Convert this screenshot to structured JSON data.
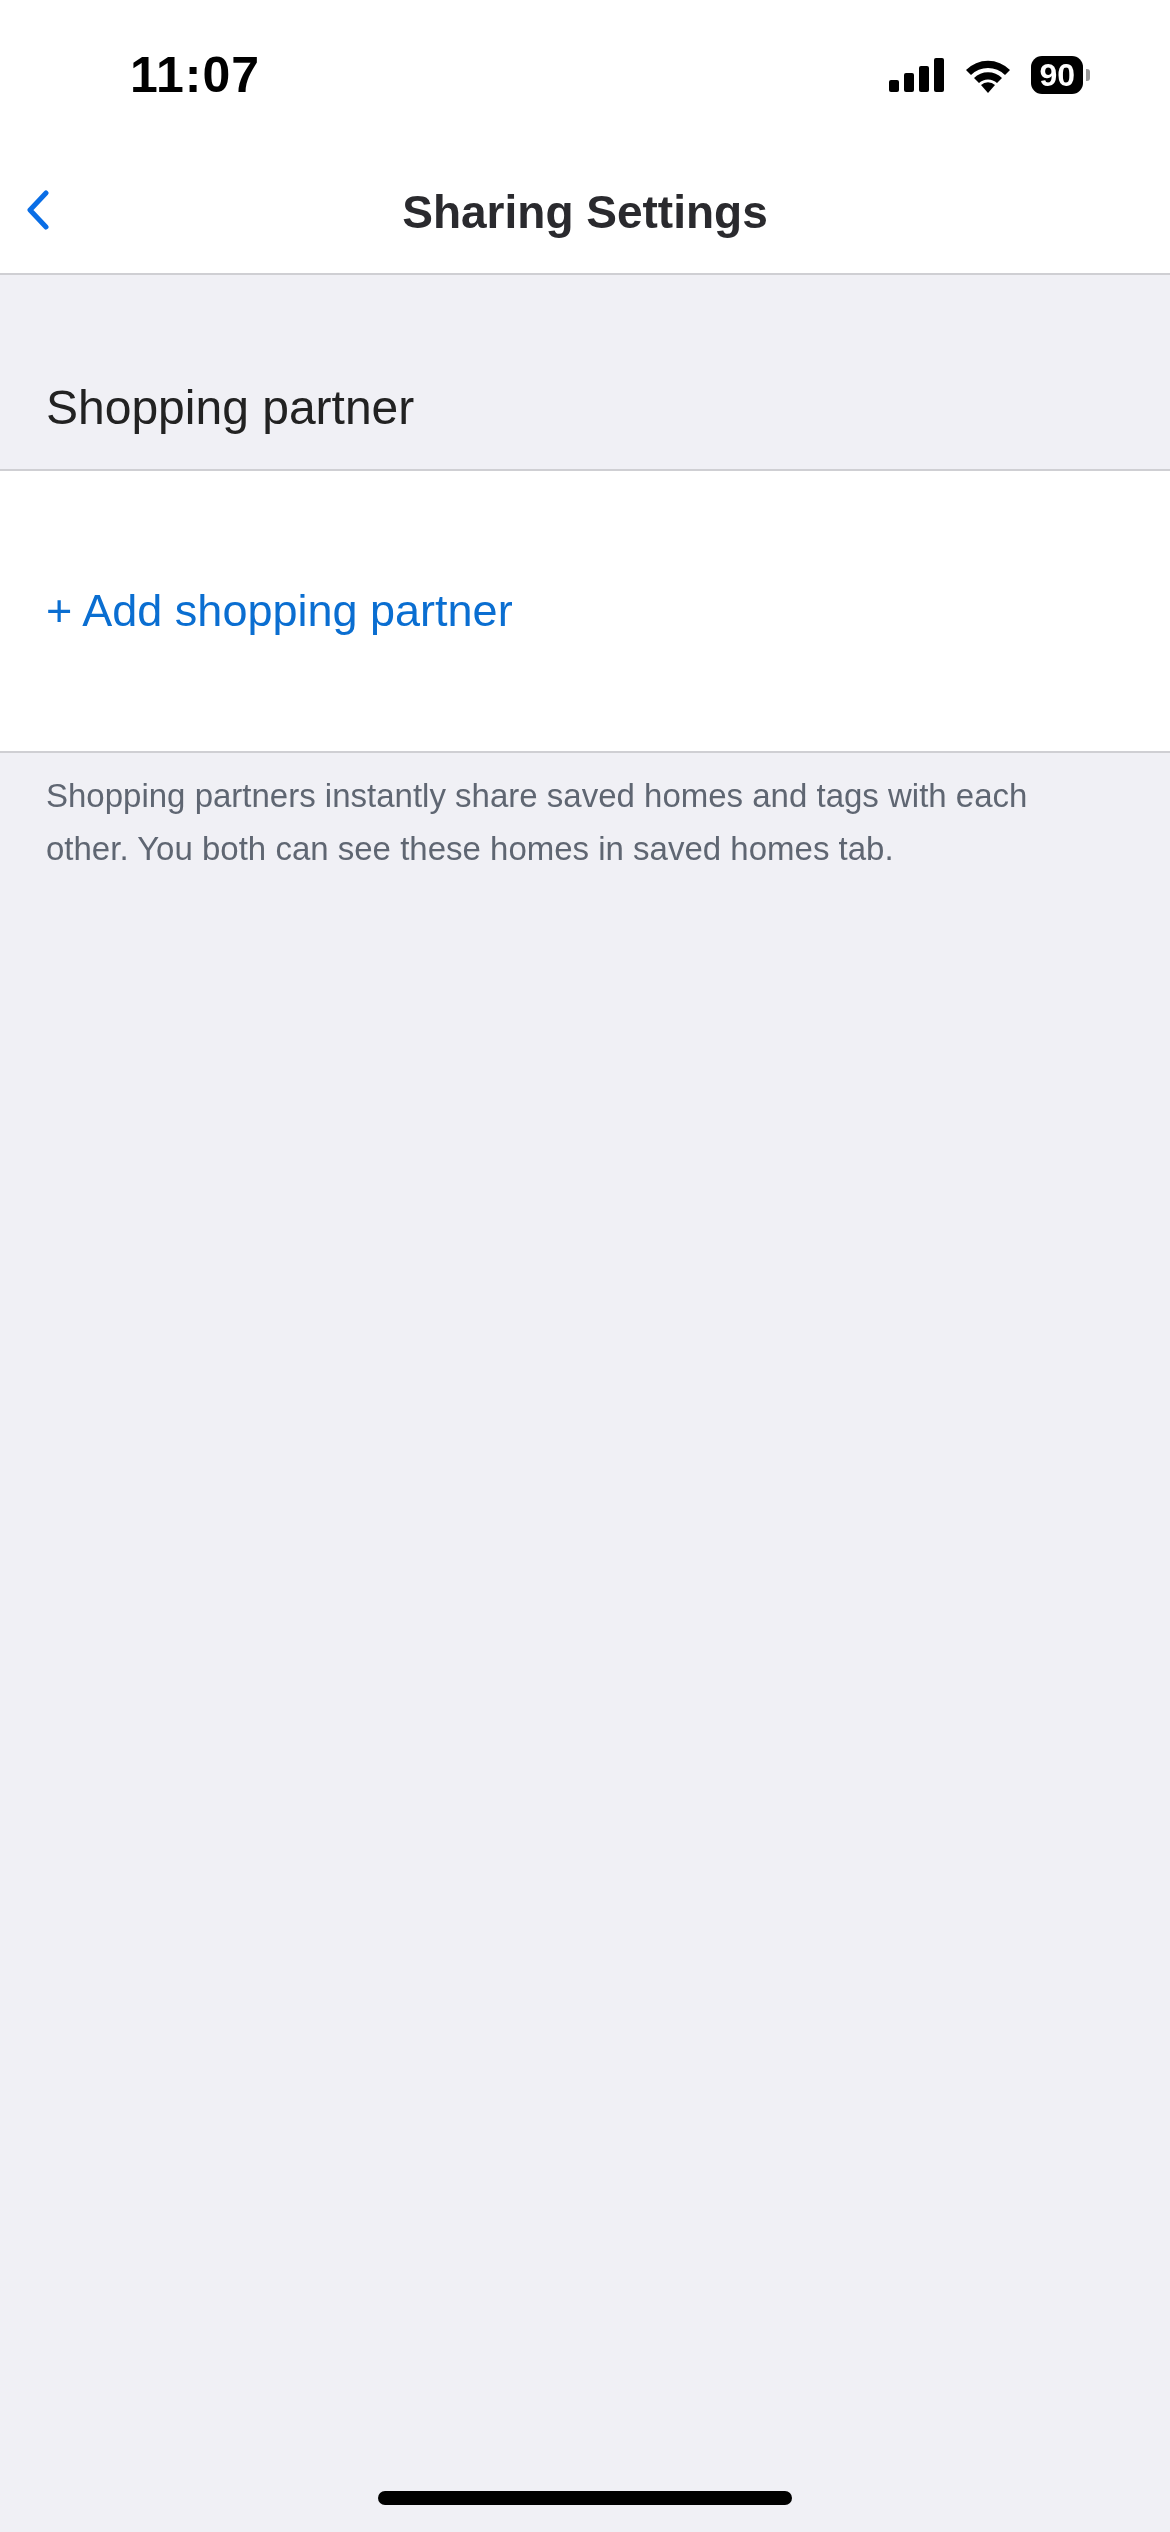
{
  "status_bar": {
    "time": "11:07",
    "battery": "90"
  },
  "nav_bar": {
    "title": "Sharing Settings"
  },
  "section": {
    "header": "Shopping partner",
    "action": "+ Add shopping partner",
    "footer": "Shopping partners instantly share saved homes and tags with each other. You both can see these homes in saved homes tab."
  }
}
